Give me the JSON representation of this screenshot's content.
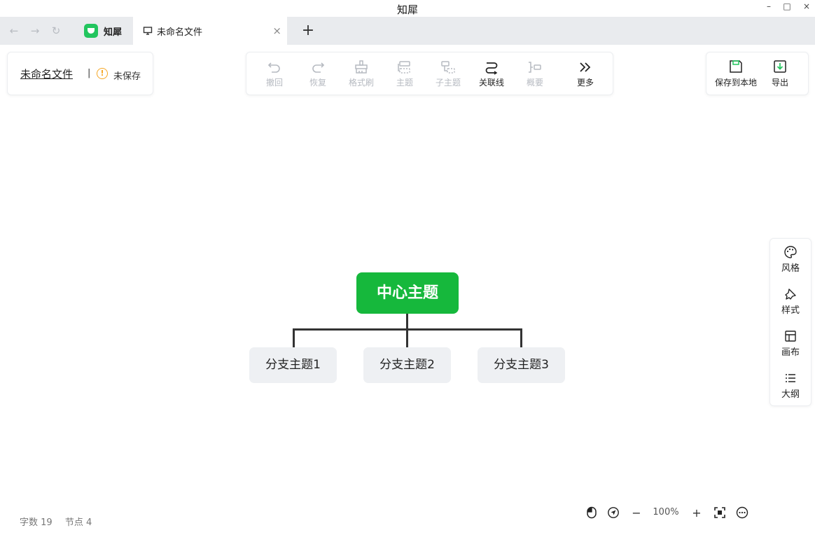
{
  "window": {
    "title": "知犀",
    "minimize_glyph": "–",
    "maximize_glyph": "□",
    "close_glyph": "×"
  },
  "tabs": {
    "back_icon": "←",
    "forward_icon": "→",
    "reload_icon": "↻",
    "home_label": "知犀",
    "doc_label": "未命名文件",
    "close_glyph": "×",
    "new_tab_glyph": "+"
  },
  "file": {
    "name": "未命名文件",
    "separator": "|",
    "warn_glyph": "!",
    "status": "未保存"
  },
  "toolbar": {
    "items": [
      {
        "label": "撤回",
        "icon": "undo-icon",
        "enabled": false
      },
      {
        "label": "恢复",
        "icon": "redo-icon",
        "enabled": false
      },
      {
        "label": "格式刷",
        "icon": "format-brush-icon",
        "enabled": false
      },
      {
        "label": "主题",
        "icon": "topic-icon",
        "enabled": false
      },
      {
        "label": "子主题",
        "icon": "subtopic-icon",
        "enabled": false
      },
      {
        "label": "关联线",
        "icon": "relation-line-icon",
        "enabled": true
      },
      {
        "label": "概要",
        "icon": "summary-icon",
        "enabled": false
      },
      {
        "label": "更多",
        "icon": "more-chevrons-icon",
        "enabled": true
      }
    ]
  },
  "save_actions": {
    "save_label": "保存到本地",
    "export_label": "导出"
  },
  "side_panel": {
    "style_label": "风格",
    "format_label": "样式",
    "canvas_label": "画布",
    "outline_label": "大纲"
  },
  "mindmap": {
    "center": "中心主题",
    "branches": [
      "分支主题1",
      "分支主题2",
      "分支主题3"
    ]
  },
  "status": {
    "word_count": "字数 19",
    "node_count": "节点 4"
  },
  "zoom": {
    "minus": "−",
    "value": "100%",
    "plus": "+"
  },
  "colors": {
    "accent": "#16b83c",
    "warning": "#f5a623"
  }
}
